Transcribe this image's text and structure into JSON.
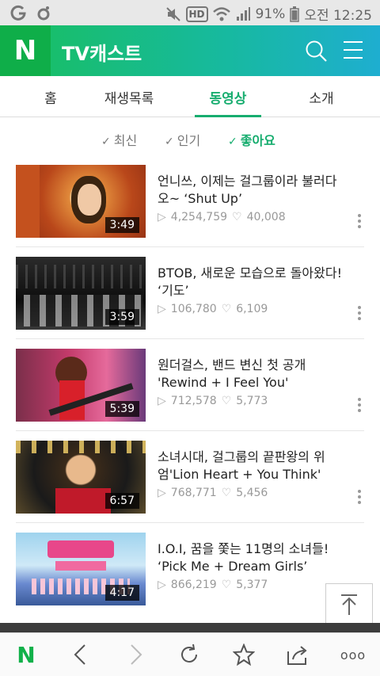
{
  "status_bar": {
    "battery": "91%",
    "time": "오전 12:25",
    "hd_label": "HD"
  },
  "app": {
    "logo_letter": "N",
    "title": "TV캐스트",
    "accent_color": "#17ad6f"
  },
  "tabs": [
    {
      "label": "홈",
      "active": false
    },
    {
      "label": "재생목록",
      "active": false
    },
    {
      "label": "동영상",
      "active": true
    },
    {
      "label": "소개",
      "active": false
    }
  ],
  "filters": [
    {
      "label": "최신",
      "active": false
    },
    {
      "label": "인기",
      "active": false
    },
    {
      "label": "좋아요",
      "active": true
    }
  ],
  "videos": [
    {
      "title": "언니쓰, 이제는 걸그룹이라 불러다오~ ‘Shut Up’",
      "duration": "3:49",
      "views": "4,254,759",
      "likes": "40,008"
    },
    {
      "title": "BTOB, 새로운 모습으로 돌아왔다! ‘기도’",
      "duration": "3:59",
      "views": "106,780",
      "likes": "6,109"
    },
    {
      "title": "원더걸스, 밴드 변신 첫 공개 'Rewind + I Feel You'",
      "duration": "5:39",
      "views": "712,578",
      "likes": "5,773"
    },
    {
      "title": "소녀시대, 걸그룹의 끝판왕의 위엄'Lion Heart + You Think'",
      "duration": "6:57",
      "views": "768,771",
      "likes": "5,456"
    },
    {
      "title": "I.O.I, 꿈을 쫓는 11명의 소녀들! ‘Pick Me + Dream Girls’",
      "duration": "4:17",
      "views": "866,219",
      "likes": "5,377"
    }
  ],
  "bottom_bar": {
    "home_letter": "N",
    "more_label": "ooo"
  }
}
